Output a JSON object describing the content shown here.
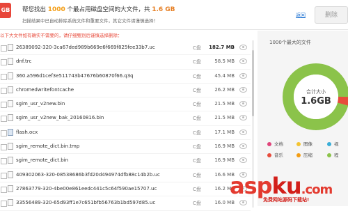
{
  "header": {
    "logo": "GB",
    "title_pre": "帮您找出",
    "title_count": "1000",
    "title_mid": "个最占用磁盘空间的大文件，共",
    "title_size": "1.6 GB",
    "subtitle": "扫描结果中已自动排除系统文件和重要文件，其它文件请谨慎选择！",
    "back_link": "返回",
    "delete_button": "删除"
  },
  "warning": "以下大文件如有确实不需要的，请仔细甄别后谨慎选择删除：",
  "files": [
    {
      "name": "26389092-320-3ca67ded989b669e6f669f825fee33b7.uc",
      "drive": "C盘",
      "size": "182.7 MB",
      "highlight": true,
      "icon": "file"
    },
    {
      "name": "dnf.trc",
      "drive": "C盘",
      "size": "58.5 MB",
      "highlight": false,
      "icon": "file"
    },
    {
      "name": "360.a596d1cef3e511743b47676b60870f66.q3q",
      "drive": "C盘",
      "size": "45.4 MB",
      "highlight": false,
      "icon": "file"
    },
    {
      "name": "chromedwritefontcache",
      "drive": "C盘",
      "size": "26.2 MB",
      "highlight": false,
      "icon": "file"
    },
    {
      "name": "sgim_usr_v2new.bin",
      "drive": "C盘",
      "size": "21.5 MB",
      "highlight": false,
      "icon": "file"
    },
    {
      "name": "sgim_usr_v2new_bak_20160816.bin",
      "drive": "C盘",
      "size": "21.5 MB",
      "highlight": false,
      "icon": "file"
    },
    {
      "name": "flash.ocx",
      "drive": "C盘",
      "size": "17.1 MB",
      "highlight": false,
      "icon": "app"
    },
    {
      "name": "sgim_remote_dict.bin.tmp",
      "drive": "C盘",
      "size": "16.9 MB",
      "highlight": false,
      "icon": "file"
    },
    {
      "name": "sgim_remote_dict.bin",
      "drive": "C盘",
      "size": "16.9 MB",
      "highlight": false,
      "icon": "file"
    },
    {
      "name": "409302063-320-08538686b3fd20d494974dfb88c14b2b.uc",
      "drive": "C盘",
      "size": "16.6 MB",
      "highlight": false,
      "icon": "file"
    },
    {
      "name": "27863779-320-4be00e861eedc441c5c64f590ae15707.uc",
      "drive": "C盘",
      "size": "16.2 MB",
      "highlight": false,
      "icon": "file"
    },
    {
      "name": "33556489-320-65d93ff1e7c651bfb56763b1bd597d85.uc",
      "drive": "C盘",
      "size": "16.0 MB",
      "highlight": false,
      "icon": "file"
    }
  ],
  "side": {
    "title": "1000个最大的文件",
    "center_label": "合计大小",
    "center_value": "1.6GB"
  },
  "legend": [
    {
      "label": "文档",
      "color": "#e0457b"
    },
    {
      "label": "图像",
      "color": "#f4c430"
    },
    {
      "label": "视",
      "color": "#3aaed8"
    },
    {
      "label": "音乐",
      "color": "#e74c3c"
    },
    {
      "label": "压缩",
      "color": "#f39c12"
    },
    {
      "label": "程",
      "color": "#8bc34a"
    }
  ],
  "watermark": {
    "main_a": "asp",
    "main_b": "ku",
    "main_c": ".com",
    "sub": "免费网站源码下载站!"
  }
}
